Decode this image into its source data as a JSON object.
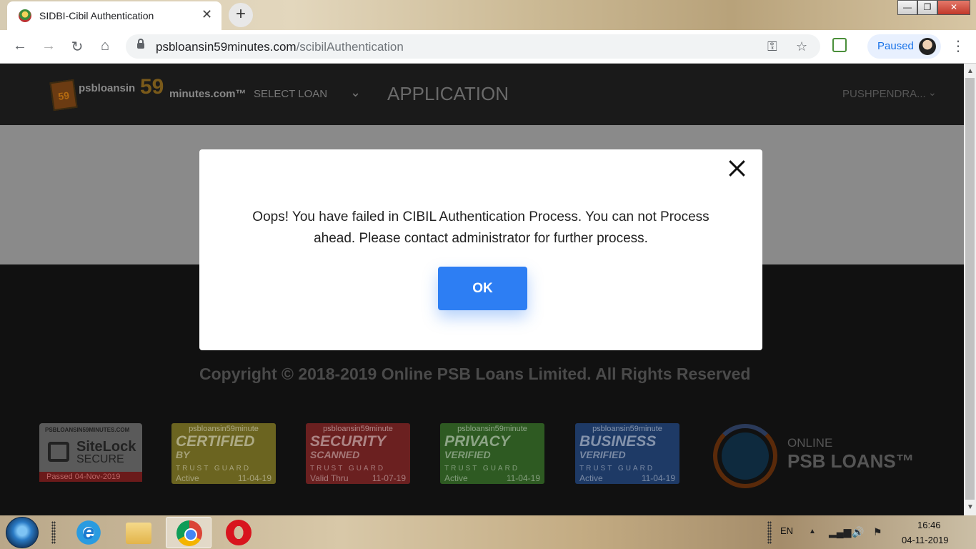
{
  "browser": {
    "tab_title": "SIDBI-Cibil Authentication",
    "tab_close": "✕",
    "new_tab": "+",
    "url_domain": "psbloansin59minutes.com",
    "url_path": "/scibilAuthentication",
    "profile_status": "Paused",
    "window_controls": {
      "minimize": "—",
      "maximize": "❐",
      "close": "✕"
    }
  },
  "site": {
    "logo_badge": "59",
    "logo_text_left": "psbloansin",
    "logo_number": "59",
    "logo_text_right": "minutes.com™",
    "nav_select_loan": "SELECT LOAN",
    "page_heading": "APPLICATION",
    "user_name": "PUSHPENDRA...",
    "copyright": "Copyright © 2018-2019 Online PSB Loans Limited. All Rights Reserved"
  },
  "trust_seals": {
    "sitelock": {
      "site": "PSBLOANSIN59MINUTES.COM",
      "brand_a": "SiteLock",
      "brand_b": "SECURE",
      "status": "Passed  04-Nov-2019"
    },
    "badges": [
      {
        "site": "psbloansin59minute",
        "line1": "CERTIFIED",
        "line2": "BY",
        "guard": "TRUST GUARD",
        "status": "Active",
        "date": "11-04-19",
        "color": "#6b6420"
      },
      {
        "site": "psbloansin59minute",
        "line1": "SECURITY",
        "line2": "SCANNED",
        "guard": "TRUST GUARD",
        "status": "Valid Thru",
        "date": "11-07-19",
        "color": "#6b2020"
      },
      {
        "site": "psbloansin59minute",
        "line1": "PRIVACY",
        "line2": "VERIFIED",
        "guard": "TRUST GUARD",
        "status": "Active",
        "date": "11-04-19",
        "color": "#2e5a22"
      },
      {
        "site": "psbloansin59minute",
        "line1": "BUSINESS",
        "line2": "VERIFIED",
        "guard": "TRUST GUARD",
        "status": "Active",
        "date": "11-04-19",
        "color": "#1e3a66"
      }
    ]
  },
  "psb_logo": {
    "line1": "ONLINE",
    "line2": "PSB LOANS™"
  },
  "modal": {
    "message": "Oops! You have failed in CIBIL Authentication Process. You can not Process ahead. Please contact administrator for further process.",
    "ok_label": "OK"
  },
  "taskbar": {
    "language": "EN",
    "time": "16:46",
    "date": "04-11-2019"
  }
}
